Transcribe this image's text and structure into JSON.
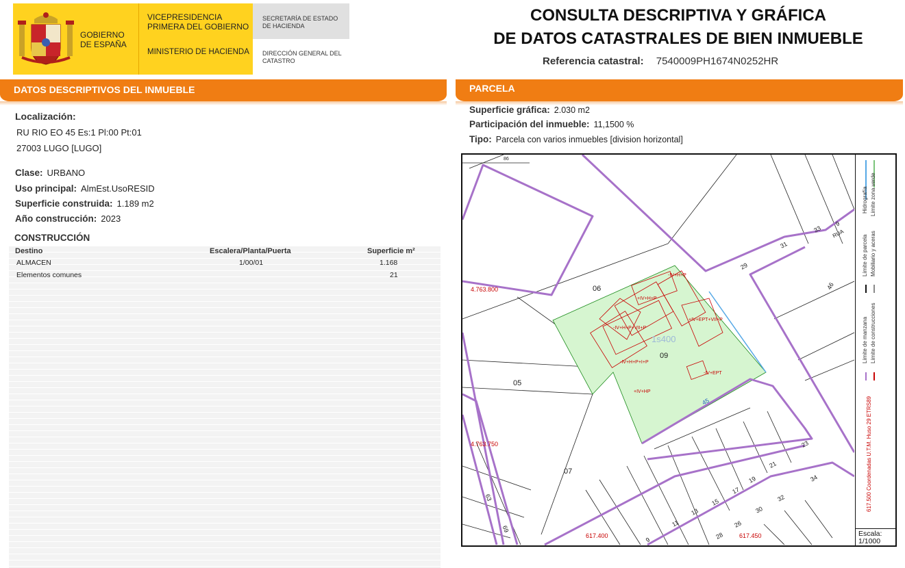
{
  "header": {
    "gobierno": "GOBIERNO DE ESPAÑA",
    "vicepresidencia": "VICEPRESIDENCIA PRIMERA DEL GOBIERNO",
    "ministerio": "MINISTERIO DE HACIENDA",
    "secretaria": "SECRETARÍA DE ESTADO DE HACIENDA",
    "direccion": "DIRECCIÓN GENERAL DEL CATASTRO",
    "title_line1": "CONSULTA DESCRIPTIVA Y GRÁFICA",
    "title_line2": "DE DATOS CATASTRALES DE BIEN INMUEBLE",
    "ref_label": "Referencia catastral:",
    "ref_value": "7540009PH1674N0252HR"
  },
  "descriptivos": {
    "bar_label": "DATOS DESCRIPTIVOS DEL INMUEBLE",
    "localizacion_label": "Localización:",
    "localizacion_line1": "RU RIO EO 45 Es:1 Pl:00 Pt:01",
    "localizacion_line2": "27003 LUGO [LUGO]",
    "clase_label": "Clase:",
    "clase_value": "URBANO",
    "uso_label": "Uso principal:",
    "uso_value": "AlmEst.UsoRESID",
    "superficie_label": "Superficie construida:",
    "superficie_value": "1.189 m2",
    "ano_label": "Año construcción:",
    "ano_value": "2023"
  },
  "construccion": {
    "heading": "CONSTRUCCIÓN",
    "columns": [
      "Destino",
      "Escalera/Planta/Puerta",
      "Superficie m²"
    ],
    "rows": [
      {
        "destino": "ALMACEN",
        "epp": "1/00/01",
        "superficie": "1.168"
      },
      {
        "destino": "Elementos comunes",
        "epp": "",
        "superficie": "21"
      }
    ]
  },
  "parcela": {
    "bar_label": "PARCELA",
    "sup_label": "Superficie gráfica:",
    "sup_value": "2.030 m2",
    "part_label": "Participación del inmueble:",
    "part_value": "11,1500 %",
    "tipo_label": "Tipo:",
    "tipo_value": "Parcela con varios inmuebles [division horizontal]"
  },
  "map": {
    "parcel_labels": [
      "06",
      "09",
      "05",
      "07"
    ],
    "coord_labels": [
      "4.763.800",
      "4.763.750",
      "617.400",
      "617.450"
    ],
    "street_numbers": [
      "86",
      "33",
      "31",
      "29",
      "9",
      "46",
      "45",
      "23",
      "21",
      "19",
      "17",
      "15",
      "13",
      "11",
      "9",
      "34",
      "32",
      "30",
      "28",
      "26",
      "63",
      "69"
    ],
    "street_name": "RUA",
    "ghost_label": "1s400",
    "floor_labels": [
      "-IV+H+P",
      "+IV+H+P",
      "-IV+H+P+I+P",
      "-IV+H+P+VII+P",
      "-IV+EPT",
      "+IV+HP",
      "+IV+EPT+VII+P"
    ],
    "escala_label": "Escala:",
    "escala_value": "1/1000",
    "legend": [
      "Hidrografía",
      "Límite zona verde",
      "Límite de parcela",
      "Mobiliario y aceras",
      "Límite de manzana",
      "Límite de construcciones",
      "617.500 Coordenadas U.T.M. Huso 29 ETRS89"
    ],
    "colors": {
      "parcel_fill": "#d6f5d0",
      "boundary": "#a772c9",
      "construction": "#c80000",
      "hidrografia": "#55a8e6"
    }
  }
}
